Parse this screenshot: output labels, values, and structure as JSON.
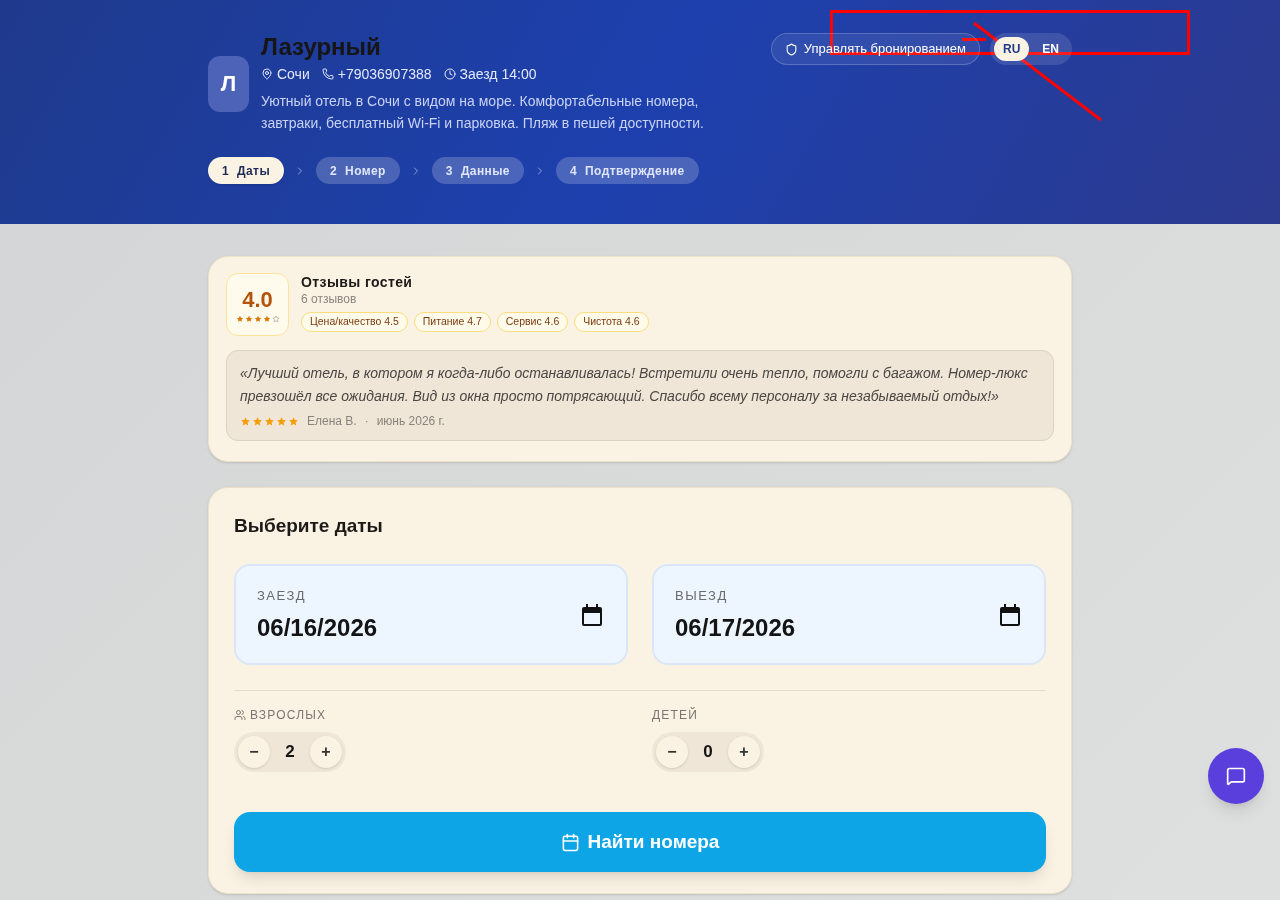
{
  "hotel": {
    "logo_letter": "Л",
    "name": "Лазурный",
    "city": "Сочи",
    "phone": "+79036907388",
    "checkin": "Заезд 14:00",
    "description": "Уютный отель в Сочи с видом на море. Комфортабельные номера, завтраки, бесплатный Wi-Fi и парковка. Пляж в пешей доступности."
  },
  "header_actions": {
    "manage_button": "Управлять бронированием",
    "languages": [
      {
        "label": "RU",
        "selected": true
      },
      {
        "label": "EN",
        "selected": false
      }
    ]
  },
  "steps": [
    {
      "number": "1",
      "label": "Даты",
      "selected": true
    },
    {
      "number": "2",
      "label": "Номер",
      "selected": false
    },
    {
      "number": "3",
      "label": "Данные",
      "selected": false
    },
    {
      "number": "4",
      "label": "Подтверждение",
      "selected": false
    }
  ],
  "reviews": {
    "rating": "4.0",
    "stars": 4,
    "title": "Отзывы гостей",
    "count": "6 отзывов",
    "categories": [
      "Цена/качество 4.5",
      "Питание 4.7",
      "Сервис 4.6",
      "Чистота 4.6"
    ],
    "featured": {
      "text": "«Лучший отель, в котором я когда-либо останавливалась! Встретили очень тепло, помогли с багажом. Номер-люкс превзошёл все ожидания. Вид из окна просто потрясающий. Спасибо всему персоналу за незабываемый отдых!»",
      "stars": 5,
      "author": "Елена В.",
      "separator": "·",
      "date": "июнь 2026 г."
    }
  },
  "dates_form": {
    "title": "Выберите даты",
    "fields": [
      {
        "label": "ЗАЕЗД",
        "value": "06/16/2026"
      },
      {
        "label": "ВЫЕЗД",
        "value": "06/17/2026"
      }
    ],
    "guests": [
      {
        "kind": "adults",
        "label": "ВЗРОСЛЫХ",
        "minus": "−",
        "value": "2",
        "plus": "+"
      },
      {
        "kind": "children",
        "label": "ДЕТЕЙ",
        "minus": "−",
        "value": "0",
        "plus": "+"
      }
    ],
    "submit": "Найти номера"
  }
}
